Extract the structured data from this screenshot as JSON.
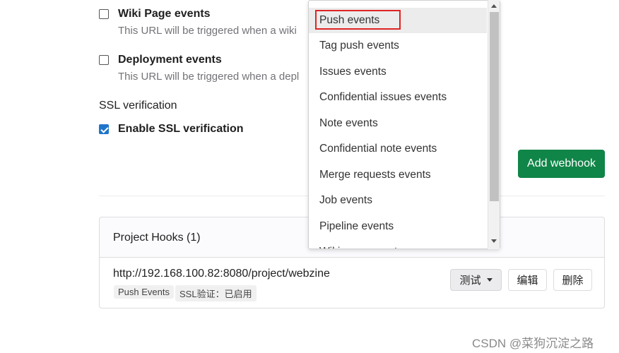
{
  "triggers": {
    "wiki": {
      "title": "Wiki Page events",
      "help": "This URL will be triggered when a wiki",
      "checked": false
    },
    "deployment": {
      "title": "Deployment events",
      "help": "This URL will be triggered when a depl",
      "checked": false
    }
  },
  "ssl": {
    "section_label": "SSL verification",
    "checkbox_label": "Enable SSL verification",
    "checked": true
  },
  "actions": {
    "add_webhook": "Add webhook"
  },
  "project_hooks": {
    "header": "Project Hooks (1)",
    "hooks": [
      {
        "url": "http://192.168.100.82:8080/project/webzine",
        "badges": [
          "Push Events",
          "SSL验证：已启用"
        ],
        "test_label": "测试",
        "edit_label": "编辑",
        "delete_label": "删除"
      }
    ]
  },
  "event_dropdown": {
    "selected": "Push events",
    "items": [
      "Push events",
      "Tag push events",
      "Issues events",
      "Confidential issues events",
      "Note events",
      "Confidential note events",
      "Merge requests events",
      "Job events",
      "Pipeline events",
      "Wiki page events"
    ]
  },
  "watermark": "CSDN @菜狗沉淀之路",
  "colors": {
    "primary_green": "#108548",
    "checkbox_blue": "#1f75cb",
    "highlight_red": "#e02424"
  }
}
